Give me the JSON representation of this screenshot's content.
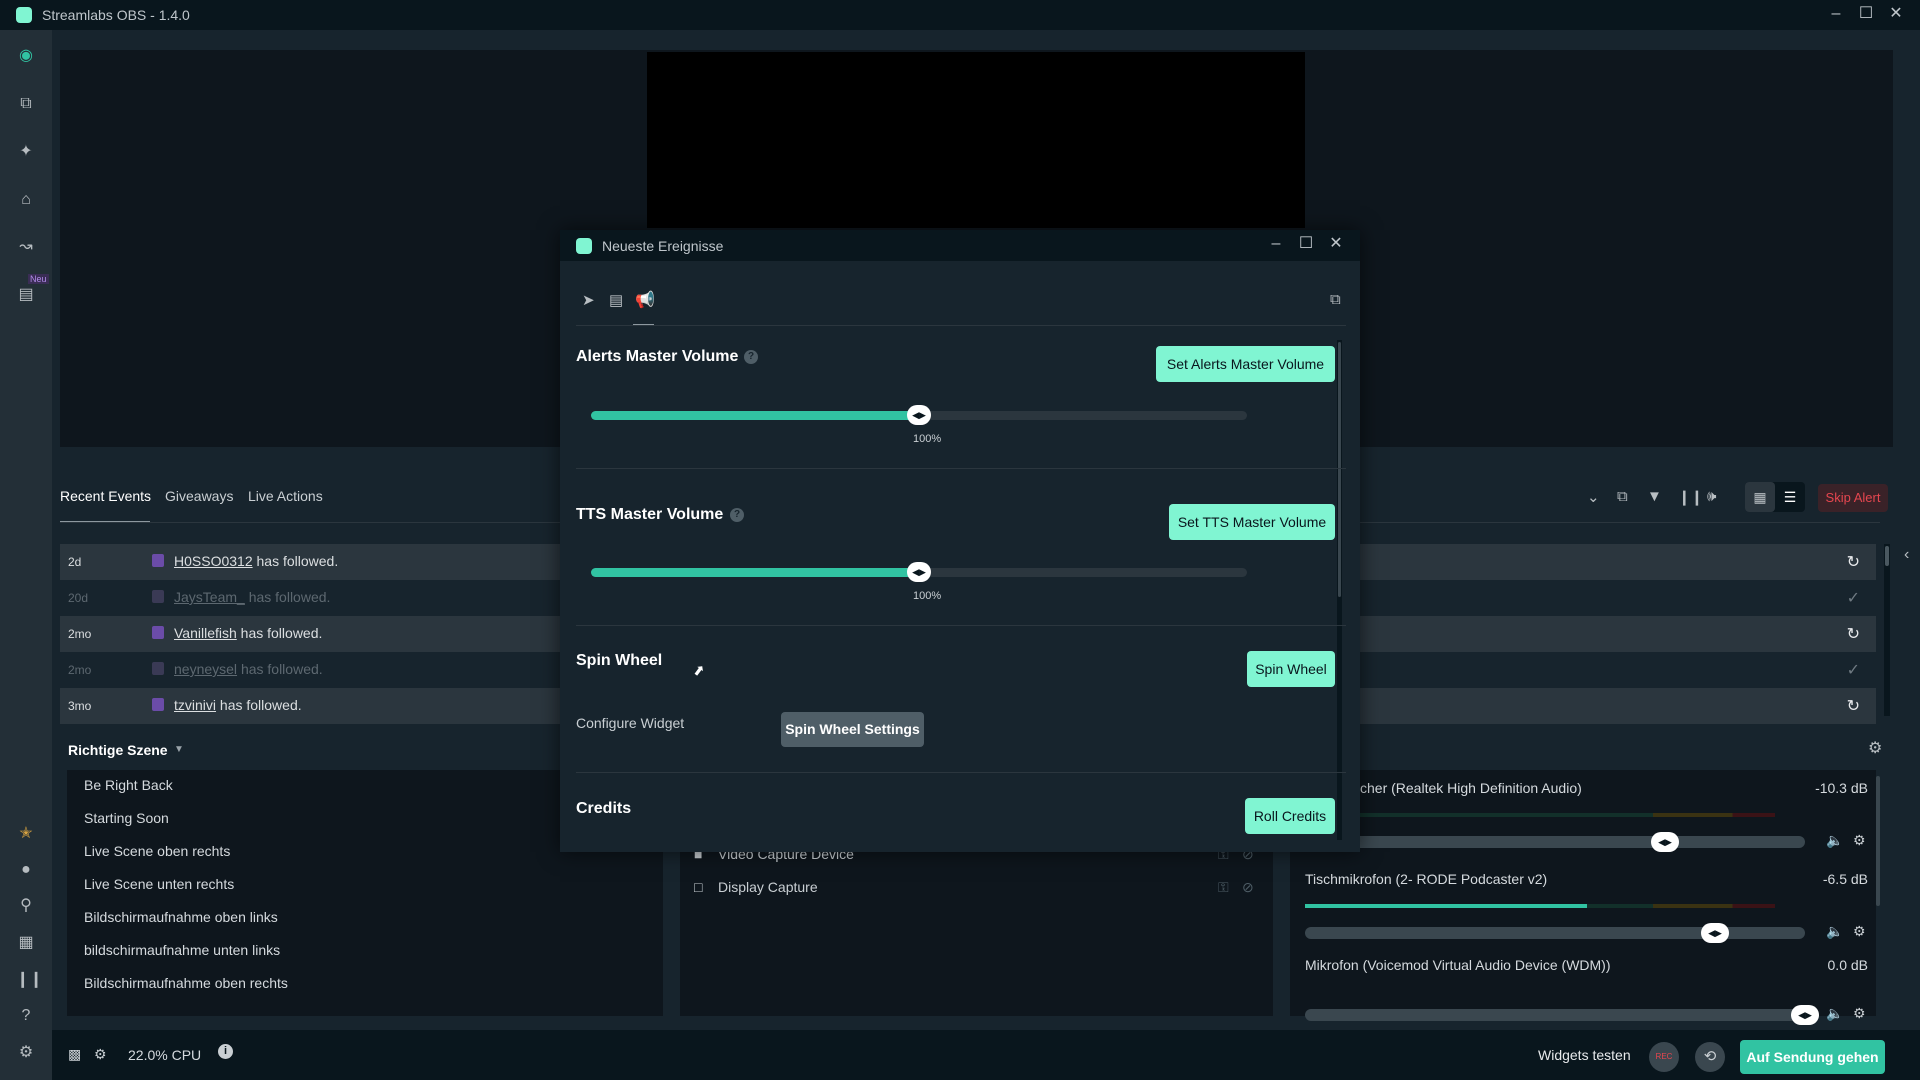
{
  "app": {
    "title": "Streamlabs OBS - 1.4.0",
    "accent": "#80f5d2",
    "window_controls": [
      "minimize-icon",
      "maximize-icon",
      "close-icon"
    ]
  },
  "sidebar": {
    "top": [
      {
        "icon": "studio-camera-icon"
      },
      {
        "icon": "layout-icon"
      },
      {
        "icon": "themes-icon"
      },
      {
        "icon": "store-icon"
      },
      {
        "icon": "dashboard-chart-icon"
      },
      {
        "icon": "highlighter-icon",
        "badge": "Neu"
      }
    ],
    "bottom": [
      {
        "icon": "prime-icon"
      },
      {
        "icon": "merch-icon"
      },
      {
        "icon": "chat-icon"
      },
      {
        "icon": "apps-icon"
      },
      {
        "icon": "layout-editor-icon"
      },
      {
        "icon": "help-icon"
      },
      {
        "icon": "settings-icon"
      }
    ]
  },
  "events": {
    "tabs": [
      "Recent Events",
      "Giveaways",
      "Live Actions"
    ],
    "active_tab": "Recent Events",
    "toolbar_icons": [
      "chevron-down-icon",
      "popout-icon",
      "filter-icon",
      "pause-icon",
      "volume-icon",
      "compact-view-icon",
      "list-view-icon"
    ],
    "skip_alert": "Skip Alert",
    "rows": [
      {
        "age": "2d",
        "user": "H0SSO0312",
        "text": "has followed.",
        "action": "repeat-icon",
        "read": false
      },
      {
        "age": "20d",
        "user": "JaysTeam_",
        "text": "has followed.",
        "action": "check-icon",
        "read": true
      },
      {
        "age": "2mo",
        "user": "Vanillefish",
        "text": "has followed.",
        "action": "repeat-icon",
        "read": false
      },
      {
        "age": "2mo",
        "user": "neyneysel",
        "text": "has followed.",
        "action": "check-icon",
        "read": true
      },
      {
        "age": "3mo",
        "user": "tzvinivi",
        "text": "has followed.",
        "action": "repeat-icon",
        "read": false
      }
    ]
  },
  "scenes": {
    "collection": "Richtige Szene",
    "items": [
      "Be Right Back",
      "Starting Soon",
      "Live Scene oben rechts",
      "Live Scene unten rechts",
      "Bildschirmaufnahme oben links",
      "bildschirmaufnahme unten links",
      "Bildschirmaufnahme oben rechts"
    ]
  },
  "sources": {
    "items": [
      {
        "name": "Video Capture Device",
        "icon": "camera-icon"
      },
      {
        "name": "Display Capture",
        "icon": "monitor-icon"
      }
    ]
  },
  "mixer": {
    "items": [
      {
        "name": "cher (Realtek High Definition Audio)",
        "db": "-10.3 dB",
        "volume": 0.72,
        "level": 0
      },
      {
        "name": "Tischmikrofon (2- RODE Podcaster v2)",
        "db": "-6.5 dB",
        "volume": 0.82,
        "level": 0.6
      },
      {
        "name": "Mikrofon (Voicemod Virtual Audio Device (WDM))",
        "db": "0.0 dB",
        "volume": 1.0,
        "level": 0
      }
    ]
  },
  "statusbar": {
    "cpu": "22.0% CPU",
    "widgets_test": "Widgets testen",
    "rec": "REC",
    "go_live": "Auf Sendung gehen"
  },
  "modal": {
    "title": "Neueste Ereignisse",
    "tabs": [
      "send-icon",
      "gift-icon",
      "megaphone-icon"
    ],
    "active_tab": "megaphone-icon",
    "alerts": {
      "title": "Alerts Master Volume",
      "button": "Set Alerts Master Volume",
      "value": 100,
      "max": 200,
      "label": "100%"
    },
    "tts": {
      "title": "TTS Master Volume",
      "button": "Set TTS Master Volume",
      "value": 100,
      "max": 200,
      "label": "100%"
    },
    "spin": {
      "title": "Spin Wheel",
      "button": "Spin Wheel",
      "configure_label": "Configure Widget",
      "settings_button": "Spin Wheel Settings"
    },
    "credits": {
      "title": "Credits",
      "button": "Roll Credits"
    }
  }
}
